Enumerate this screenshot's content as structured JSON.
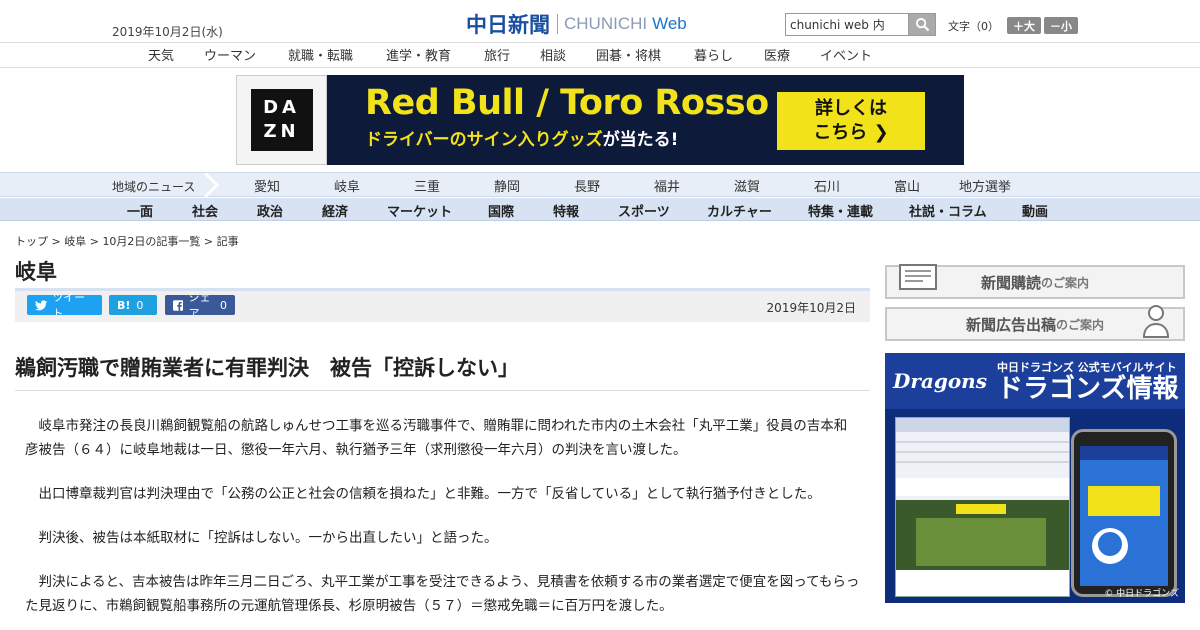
{
  "header": {
    "date": "2019年10月2日(水)",
    "logo_jp": "中日新聞",
    "logo_en": "CHUNICHI",
    "logo_web": "Web",
    "search_value": "chunichi web 内",
    "fontsize_label": "文字（0）",
    "font_up": "＋大",
    "font_down": "－小"
  },
  "service_nav": [
    "天気",
    "ウーマン",
    "就職・転職",
    "進学・教育",
    "旅行",
    "相談",
    "囲碁・将棋",
    "暮らし",
    "医療",
    "イベント"
  ],
  "banner": {
    "logo": "DAZN",
    "title": "Red Bull / Toro Rosso",
    "sub_a": "ドライバーのサイン入りグッズ",
    "sub_b": "が当たる!",
    "cta_line1": "詳しくは",
    "cta_line2": "こちら ❯"
  },
  "region_nav": {
    "label": "地域のニュース",
    "items": [
      "愛知",
      "岐阜",
      "三重",
      "静岡",
      "長野",
      "福井",
      "滋賀",
      "石川",
      "富山",
      "地方選挙"
    ]
  },
  "category_nav": [
    "一面",
    "社会",
    "政治",
    "経済",
    "マーケット",
    "国際",
    "特報",
    "スポーツ",
    "カルチャー",
    "特集・連載",
    "社説・コラム",
    "動画"
  ],
  "breadcrumb": {
    "top": "トップ",
    "region": "岐阜",
    "list": "10月2日の記事一覧",
    "current": "記事",
    "sep": " > "
  },
  "section_title": "岐阜",
  "share": {
    "tweet": "ツイート",
    "hatena_label": "B!",
    "hatena_count": "0",
    "fb_label": "シェア",
    "fb_count": "0"
  },
  "article": {
    "date": "2019年10月2日",
    "headline": "鵜飼汚職で贈賄業者に有罪判決　被告「控訴しない」",
    "paragraphs": [
      "岐阜市発注の長良川鵜飼観覧船の航路しゅんせつ工事を巡る汚職事件で、贈賄罪に問われた市内の土木会社「丸平工業」役員の吉本和彦被告（６４）に岐阜地裁は一日、懲役一年六月、執行猶予三年（求刑懲役一年六月）の判決を言い渡した。",
      "出口博章裁判官は判決理由で「公務の公正と社会の信頼を損ねた」と非難。一方で「反省している」として執行猶予付きとした。",
      "判決後、被告は本紙取材に「控訴はしない。一から出直したい」と語った。",
      "判決によると、吉本被告は昨年三月二日ごろ、丸平工業が工事を受注できるよう、見積書を依頼する市の業者選定で便宜を図ってもらった見返りに、市鵜飼観覧船事務所の元運航管理係長、杉原明被告（５７）＝懲戒免職＝に百万円を渡した。"
    ]
  },
  "rail": {
    "btn1_main": "新聞購読",
    "btn1_sub": "のご案内",
    "btn2_main": "新聞広告出稿",
    "btn2_sub": "のご案内",
    "ad_logo": "Dragons",
    "ad_head_a": "中日ドラゴンズ 公式モバイルサイト",
    "ad_head_b": "ドラゴンズ情報",
    "ad_copy": "© 中日ドラゴンズ"
  }
}
